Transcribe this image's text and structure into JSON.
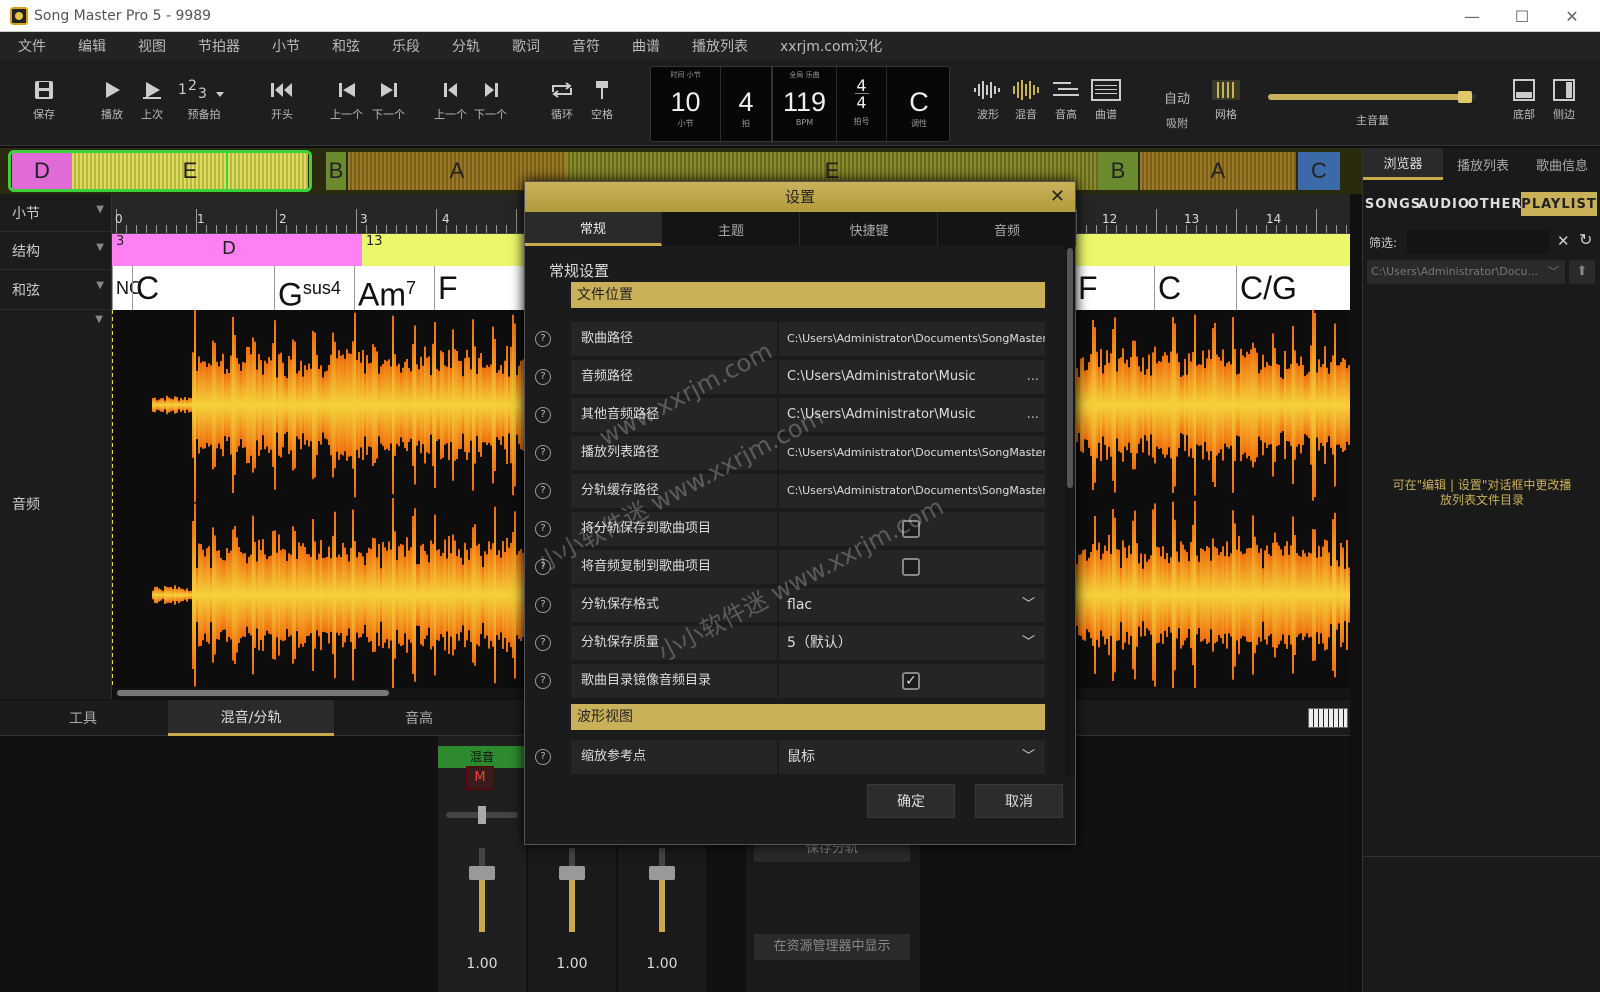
{
  "window": {
    "title": "Song Master Pro 5 - 9989"
  },
  "menu": [
    "文件",
    "编辑",
    "视图",
    "节拍器",
    "小节",
    "和弦",
    "乐段",
    "分轨",
    "歌词",
    "音符",
    "曲谱",
    "播放列表",
    "xxrjm.com汉化"
  ],
  "toolbar": {
    "save": "保存",
    "play": "播放",
    "prev_play": "上次",
    "count_in": "预备拍",
    "start": "开头",
    "prev1": "上一个",
    "next1": "下一个",
    "prev2": "上一个",
    "next2": "下一个",
    "loop": "循环",
    "blank": "空格",
    "wave": "波形",
    "mix": "混音",
    "pitch": "音高",
    "score": "曲谱",
    "auto": "自动",
    "snap": "吸附",
    "grid": "网格",
    "volume": "主音量",
    "bottom": "底部",
    "side": "侧边"
  },
  "lcd": {
    "bar": "10",
    "bar_label": "小节",
    "bar_top": "时间  小节",
    "beat": "4",
    "beat_label": "拍",
    "bpm": "119",
    "bpm_label": "BPM",
    "bpm_top": "全局  乐曲",
    "ts_num": "4",
    "ts_den": "4",
    "ts_label": "拍号",
    "key": "C",
    "key_label": "调性"
  },
  "overview": {
    "segments": [
      "D",
      "E",
      "B",
      "A",
      "E",
      "B",
      "A",
      "C"
    ]
  },
  "left_labels": {
    "bar": "小节",
    "structure": "结构",
    "chord": "和弦",
    "audio": "音频"
  },
  "ruler": {
    "numbers": [
      "0",
      "1",
      "2",
      "3",
      "4",
      "12",
      "13",
      "14"
    ]
  },
  "structure": {
    "d_num": "3",
    "d_label": "D",
    "e_num": "13"
  },
  "chords": {
    "left": [
      "NC",
      "C",
      "Gsus4",
      "Am7",
      "F"
    ],
    "right": [
      "7",
      "F",
      "C",
      "C/G"
    ]
  },
  "bottom_tabs": [
    "工具",
    "混音/分轨",
    "音高"
  ],
  "mixer": {
    "title": "混音",
    "mute": "M",
    "fader_values": [
      "1.00",
      "1.00",
      "1.00"
    ],
    "save_stems": "保存分轨",
    "show_in_explorer": "在资源管理器中显示"
  },
  "right_panel": {
    "tabs": [
      "浏览器",
      "播放列表",
      "歌曲信息"
    ],
    "subtabs": [
      "SONGS",
      "AUDIO",
      "OTHER",
      "PLAYLIST"
    ],
    "filter_label": "筛选:",
    "path": "C:\\Users\\Administrator\\Docu...",
    "note": "可在\"编辑 | 设置\"对话框中更改播放列表文件目录"
  },
  "dialog": {
    "title": "设置",
    "tabs": [
      "常规",
      "主题",
      "快捷键",
      "音频"
    ],
    "heading": "常规设置",
    "sections": {
      "file_location": "文件位置",
      "waveform": "波形视图"
    },
    "rows": {
      "song_path": {
        "label": "歌曲路径",
        "value": "C:\\Users\\Administrator\\Documents\\SongMaster\\..."
      },
      "audio_path": {
        "label": "音频路径",
        "value": "C:\\Users\\Administrator\\Music"
      },
      "other_audio_path": {
        "label": "其他音频路径",
        "value": "C:\\Users\\Administrator\\Music"
      },
      "playlist_path": {
        "label": "播放列表路径",
        "value": "C:\\Users\\Administrator\\Documents\\SongMaster\\..."
      },
      "stem_cache_path": {
        "label": "分轨缓存路径",
        "value": "C:\\Users\\Administrator\\Documents\\SongMaster\\..."
      },
      "save_stems_to_project": {
        "label": "将分轨保存到歌曲项目",
        "checked": false
      },
      "copy_audio_to_project": {
        "label": "将音频复制到歌曲项目",
        "checked": false
      },
      "stem_format": {
        "label": "分轨保存格式",
        "value": "flac"
      },
      "stem_quality": {
        "label": "分轨保存质量",
        "value": "5（默认）"
      },
      "mirror_dirs": {
        "label": "歌曲目录镜像音频目录",
        "checked": true
      },
      "zoom_ref": {
        "label": "缩放参考点",
        "value": "鼠标"
      }
    },
    "dots": "...",
    "checkmark": "✓",
    "ok": "确定",
    "cancel": "取消"
  },
  "watermarks": [
    "www.xxrjm.com",
    "小小软件迷  www.xxrjm.com",
    "小小软件迷  www.xxrjm.com"
  ],
  "colors": {
    "accent": "#c9b15a",
    "wave_orange": "#f08a14",
    "wave_yellow": "#f4d93a",
    "struct_d": "#ff7ff0",
    "struct_e": "#e9f56a"
  }
}
